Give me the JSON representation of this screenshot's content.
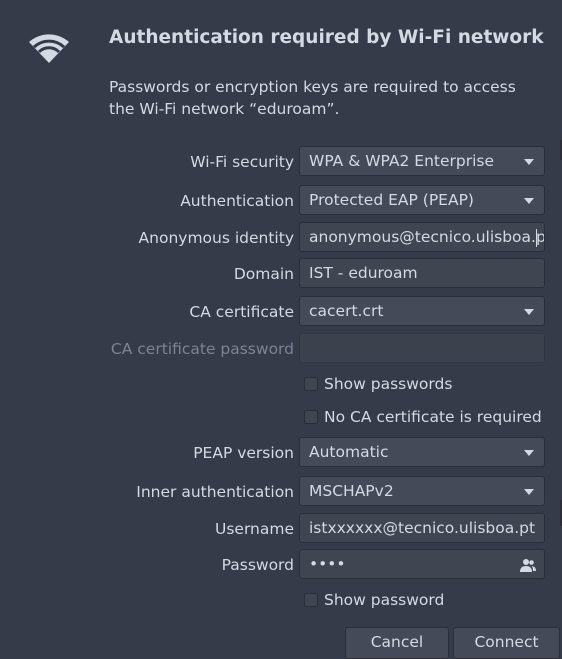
{
  "dialog": {
    "title": "Authentication required by Wi-Fi network",
    "description": "Passwords or encryption keys are required to access the Wi-Fi network “eduroam”."
  },
  "form": {
    "wifi_security": {
      "label": "Wi-Fi security",
      "value": "WPA & WPA2 Enterprise"
    },
    "authentication": {
      "label": "Authentication",
      "value": "Protected EAP (PEAP)"
    },
    "anonymous_identity": {
      "label": "Anonymous identity",
      "value": "anonymous@tecnico.ulisboa.pt"
    },
    "domain": {
      "label": "Domain",
      "value": "IST - eduroam"
    },
    "ca_certificate": {
      "label": "CA certificate",
      "value": "cacert.crt"
    },
    "ca_certificate_password": {
      "label": "CA certificate password",
      "value": ""
    },
    "show_passwords": {
      "label": "Show passwords",
      "checked": false
    },
    "no_ca_required": {
      "label": "No CA certificate is required",
      "checked": false
    },
    "peap_version": {
      "label": "PEAP version",
      "value": "Automatic"
    },
    "inner_authentication": {
      "label": "Inner authentication",
      "value": "MSCHAPv2"
    },
    "username": {
      "label": "Username",
      "value": "istxxxxxx@tecnico.ulisboa.pt"
    },
    "password": {
      "label": "Password",
      "value": "••••",
      "icon": "people-icon"
    },
    "show_password": {
      "label": "Show password",
      "checked": false
    }
  },
  "buttons": {
    "cancel": "Cancel",
    "connect": "Connect"
  },
  "icons": {
    "header": "wifi-icon"
  },
  "colors": {
    "background": "#353b48",
    "field": "#404552",
    "combo": "#444a58",
    "text": "#d3dae3",
    "dim_text": "#7c8392"
  }
}
